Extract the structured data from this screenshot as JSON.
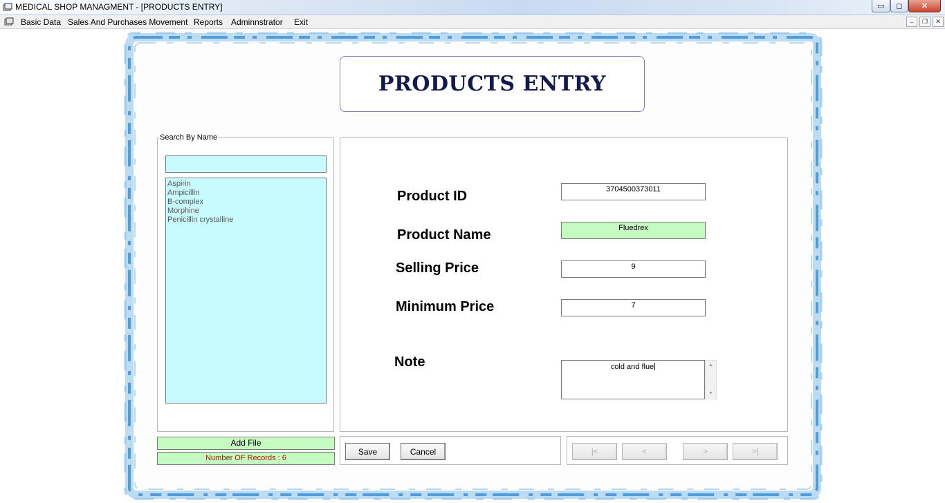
{
  "window": {
    "title": "MEDICAL SHOP MANAGMENT - [PRODUCTS ENTRY]",
    "controls": {
      "minimize": "▭",
      "maximize": "◻",
      "close": "✕"
    }
  },
  "menu": {
    "items": [
      {
        "label": "Basic Data"
      },
      {
        "label": "Sales And Purchases Movement"
      },
      {
        "label": "Reports"
      },
      {
        "label": "Adminnstrator"
      },
      {
        "label": "Exit"
      }
    ],
    "mdi_controls": {
      "minimize": "–",
      "restore": "❐",
      "close": "✕"
    }
  },
  "form": {
    "heading": "PRODUCTS ENTRY",
    "search": {
      "legend": "Search By Name",
      "value": "",
      "items": [
        "Aspirin",
        "Ampicillin",
        "B-complex",
        "Morphine",
        "Penicillin crystalline"
      ]
    },
    "add_file_label": "Add File",
    "records_label": "Number OF Records : 6",
    "fields": {
      "product_id": {
        "label": "Product ID",
        "value": "3704500373011"
      },
      "product_name": {
        "label": "Product Name",
        "value": "Fluedrex"
      },
      "selling_price": {
        "label": "Selling Price",
        "value": "9"
      },
      "minimum_price": {
        "label": "Minimum Price",
        "value": "7"
      },
      "note": {
        "label": "Note",
        "value": "cold and flue"
      }
    },
    "buttons": {
      "save": "Save",
      "cancel": "Cancel"
    },
    "nav": {
      "first": "|<",
      "prev": "<",
      "next": ">",
      "last": ">|"
    }
  },
  "colors": {
    "heading": "#141a4e",
    "input_cyan": "#c8fbfd",
    "input_green": "#c5fbc1",
    "records_text": "#a11b00",
    "frame_blue": "#4a9ad8"
  }
}
